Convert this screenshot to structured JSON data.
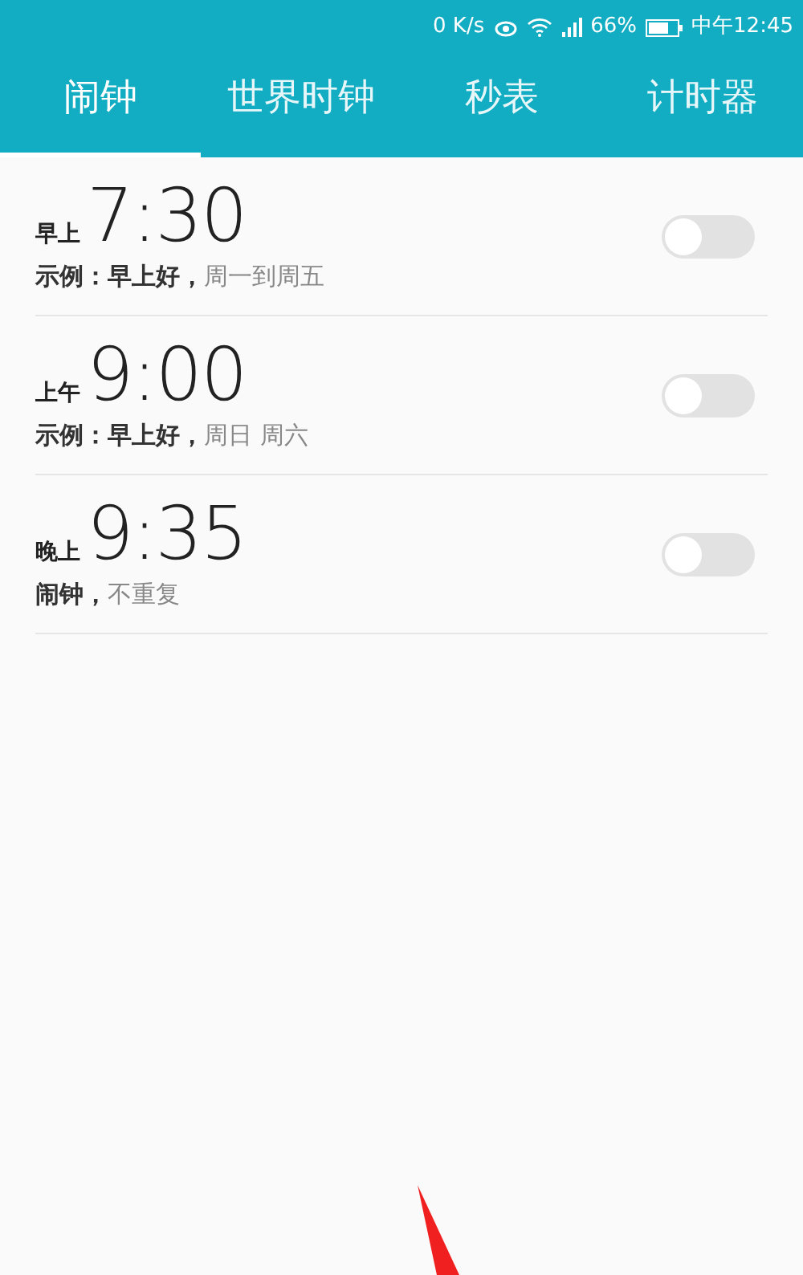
{
  "status_bar": {
    "speed": "0 K/s",
    "battery": "66%",
    "time": "中午12:45"
  },
  "tabs": [
    {
      "label": "闹钟",
      "selected": true
    },
    {
      "label": "世界时钟",
      "selected": false
    },
    {
      "label": "秒表",
      "selected": false
    },
    {
      "label": "计时器",
      "selected": false
    }
  ],
  "alarms": [
    {
      "period": "早上",
      "time": "7:30",
      "label": "示例：早上好，",
      "repeat": "周一到周五",
      "on": false
    },
    {
      "period": "上午",
      "time": "9:00",
      "label": "示例：早上好，",
      "repeat": "周日 周六",
      "on": false
    },
    {
      "period": "晚上",
      "time": "9:35",
      "label": "闹钟，",
      "repeat": "不重复",
      "on": false
    }
  ]
}
